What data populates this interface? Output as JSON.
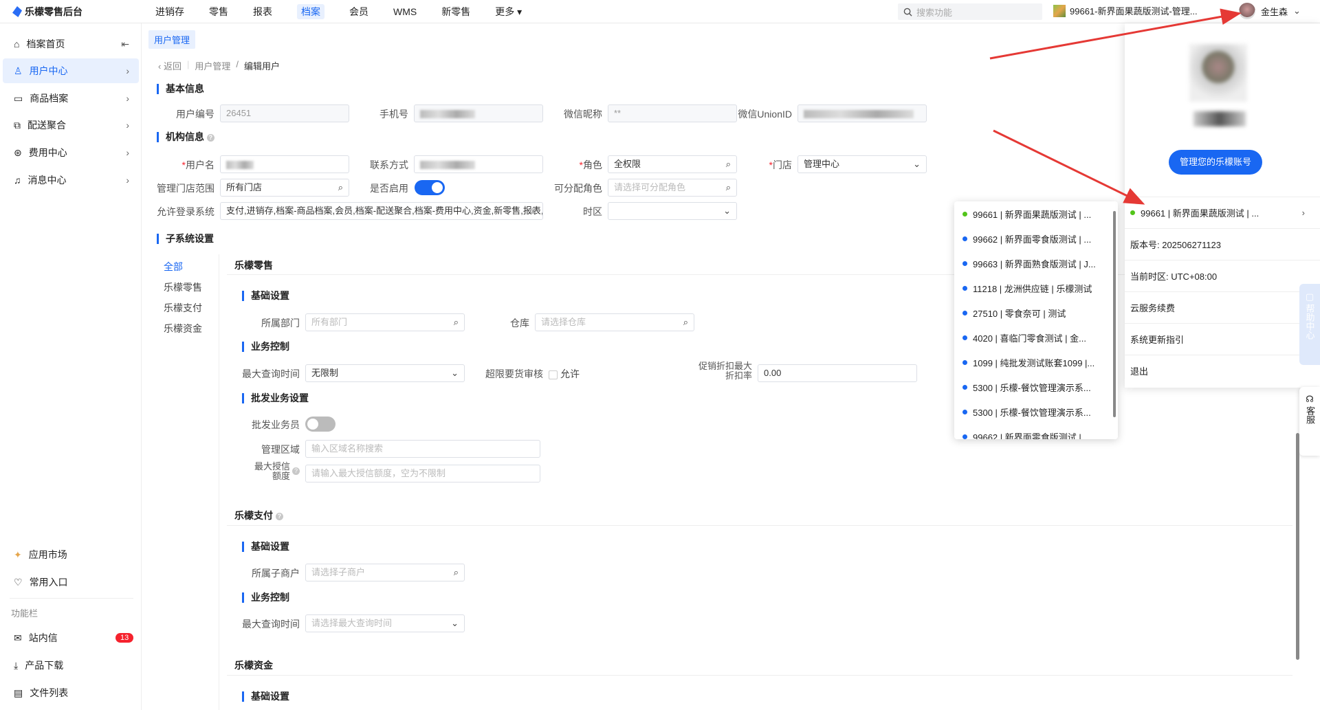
{
  "app": {
    "title": "乐檬零售后台"
  },
  "topnav": [
    "进销存",
    "零售",
    "报表",
    "档案",
    "会员",
    "WMS",
    "新零售",
    "更多"
  ],
  "topnav_active": 3,
  "search": {
    "placeholder": "搜索功能"
  },
  "current_store": "99661-新界面果蔬版测试-管理...",
  "user": {
    "name": "金生森"
  },
  "sidebar": {
    "items": [
      {
        "label": "档案首页"
      },
      {
        "label": "用户中心"
      },
      {
        "label": "商品档案"
      },
      {
        "label": "配送聚合"
      },
      {
        "label": "费用中心"
      },
      {
        "label": "消息中心"
      }
    ],
    "bottom": [
      {
        "label": "应用市场"
      },
      {
        "label": "常用入口"
      }
    ],
    "section_label": "功能栏",
    "tools": [
      {
        "label": "站内信",
        "badge": "13"
      },
      {
        "label": "产品下载"
      },
      {
        "label": "文件列表"
      }
    ]
  },
  "tab": "用户管理",
  "breadcrumb": {
    "back": "返回",
    "parent": "用户管理",
    "current": "编辑用户"
  },
  "basic": {
    "title": "基本信息",
    "user_no_label": "用户编号",
    "user_no": "26451",
    "phone_label": "手机号",
    "wechat_nick_label": "微信昵称",
    "wechat_nick": "**",
    "unionid_label": "微信UnionID"
  },
  "org": {
    "title": "机构信息",
    "username_label": "用户名",
    "contact_label": "联系方式",
    "role_label": "角色",
    "role": "全权限",
    "store_label": "门店",
    "store": "管理中心",
    "scope_label": "管理门店范围",
    "scope": "所有门店",
    "enabled_label": "是否启用",
    "assignable_label": "可分配角色",
    "assignable_ph": "请选择可分配角色",
    "systems_label": "允许登录系统",
    "systems": "支付,进销存,档案-商品档案,会员,档案-配送聚合,档案-费用中心,资金,新零售,报表,零售,档",
    "tz_label": "时区"
  },
  "subsystem": {
    "title": "子系统设置",
    "nav": [
      "全部",
      "乐檬零售",
      "乐檬支付",
      "乐檬资金"
    ],
    "retail": {
      "title": "乐檬零售",
      "basic": "基础设置",
      "dept_label": "所属部门",
      "dept_ph": "所有部门",
      "wh_label": "仓库",
      "wh_ph": "请选择仓库",
      "biz": "业务控制",
      "query_label": "最大查询时间",
      "query": "无限制",
      "over_label": "超限要货审核",
      "over_opt": "允许",
      "promo_label1": "促销折扣最大",
      "promo_label2": "折扣率",
      "promo": "0.00",
      "wholesale": "批发业务设置",
      "salesman_label": "批发业务员",
      "area_label": "管理区域",
      "area_ph": "输入区域名称搜索",
      "credit_label1": "最大授信",
      "credit_label2": "额度",
      "credit_ph": "请输入最大授信额度，空为不限制"
    },
    "pay": {
      "title": "乐檬支付",
      "basic": "基础设置",
      "merchant_label": "所属子商户",
      "merchant_ph": "请选择子商户",
      "biz": "业务控制",
      "query_label": "最大查询时间",
      "query_ph": "请选择最大查询时间"
    },
    "fund": {
      "title": "乐檬资金",
      "basic": "基础设置"
    }
  },
  "store_dropdown": {
    "items": [
      {
        "label": "99661 | 新界面果蔬版测试 | ...",
        "color": "#52c41a"
      },
      {
        "label": "99662 | 新界面零食版测试 | ...",
        "color": "#1967f2"
      },
      {
        "label": "99663 | 新界面熟食版测试 | J...",
        "color": "#1967f2"
      },
      {
        "label": "11218 | 龙洲供应链 | 乐檬测试",
        "color": "#1967f2"
      },
      {
        "label": "27510 | 零食奈可 | 测试",
        "color": "#1967f2"
      },
      {
        "label": "4020 | 喜临门零食测试 | 金...",
        "color": "#1967f2"
      },
      {
        "label": "1099 | 纯批发测试账套1099 |...",
        "color": "#1967f2"
      },
      {
        "label": "5300 | 乐檬-餐饮管理演示系...",
        "color": "#1967f2"
      },
      {
        "label": "5300 | 乐檬-餐饮管理演示系...",
        "color": "#1967f2"
      },
      {
        "label": "99662 | 新界面零食版测试 | ...",
        "color": "#1967f2"
      }
    ]
  },
  "user_panel": {
    "manage_btn": "管理您的乐檬账号",
    "current": "99661 | 新界面果蔬版测试 | ...",
    "version": "版本号: 202506271123",
    "timezone": "当前时区: UTC+08:00",
    "cloud_fee": "云服务续费",
    "guide": "系统更新指引",
    "logout": "退出"
  },
  "float": {
    "help": "帮助中心",
    "service": "客服"
  }
}
